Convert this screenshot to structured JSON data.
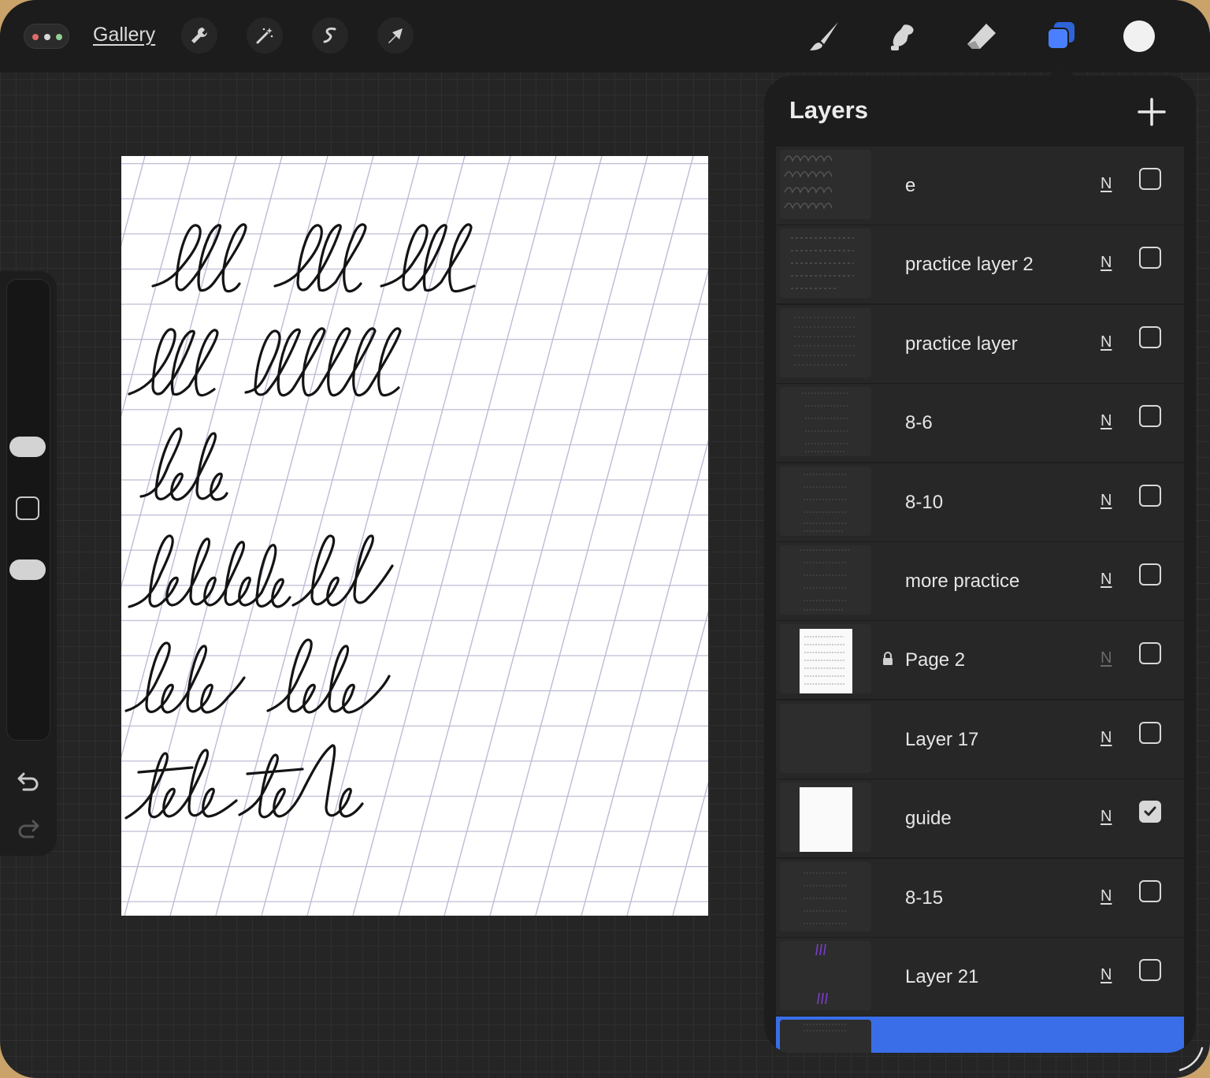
{
  "app": {
    "gallery_label": "Gallery",
    "toolbar_left": [
      "wrench-icon",
      "magic-wand-icon",
      "selection-icon",
      "transform-arrow-icon"
    ],
    "toolbar_right": [
      "brush-icon",
      "smudge-icon",
      "eraser-icon",
      "layers-icon",
      "color-swatch"
    ],
    "accent_color": "#3a6ee8",
    "current_color": "#f1f1f1"
  },
  "sidebar": {
    "controls": [
      "brush-size-slider",
      "modify-button",
      "opacity-slider",
      "undo-icon",
      "redo-icon"
    ]
  },
  "layers_panel": {
    "title": "Layers",
    "add_label": "+",
    "layers": [
      {
        "name": "e",
        "blend": "N",
        "visible": false,
        "locked": false
      },
      {
        "name": "practice layer 2",
        "blend": "N",
        "visible": false,
        "locked": false
      },
      {
        "name": "practice layer",
        "blend": "N",
        "visible": false,
        "locked": false
      },
      {
        "name": "8-6",
        "blend": "N",
        "visible": false,
        "locked": false
      },
      {
        "name": "8-10",
        "blend": "N",
        "visible": false,
        "locked": false
      },
      {
        "name": "more practice",
        "blend": "N",
        "visible": false,
        "locked": false
      },
      {
        "name": "Page 2",
        "blend": "N",
        "visible": false,
        "locked": true
      },
      {
        "name": "Layer 17",
        "blend": "N",
        "visible": false,
        "locked": false
      },
      {
        "name": "guide",
        "blend": "N",
        "visible": true,
        "locked": false
      },
      {
        "name": "8-15",
        "blend": "N",
        "visible": false,
        "locked": false
      },
      {
        "name": "Layer 21",
        "blend": "N",
        "visible": false,
        "locked": false
      },
      {
        "name": "",
        "blend": "",
        "visible": false,
        "locked": false,
        "selected": true
      }
    ]
  },
  "canvas": {
    "content": "calligraphy practice sheet with slanted guide grid",
    "handwriting_lines": [
      "lll lll lll",
      "lll llllll",
      "lele",
      "lelele lel",
      "lele lele",
      "tele tele"
    ]
  }
}
